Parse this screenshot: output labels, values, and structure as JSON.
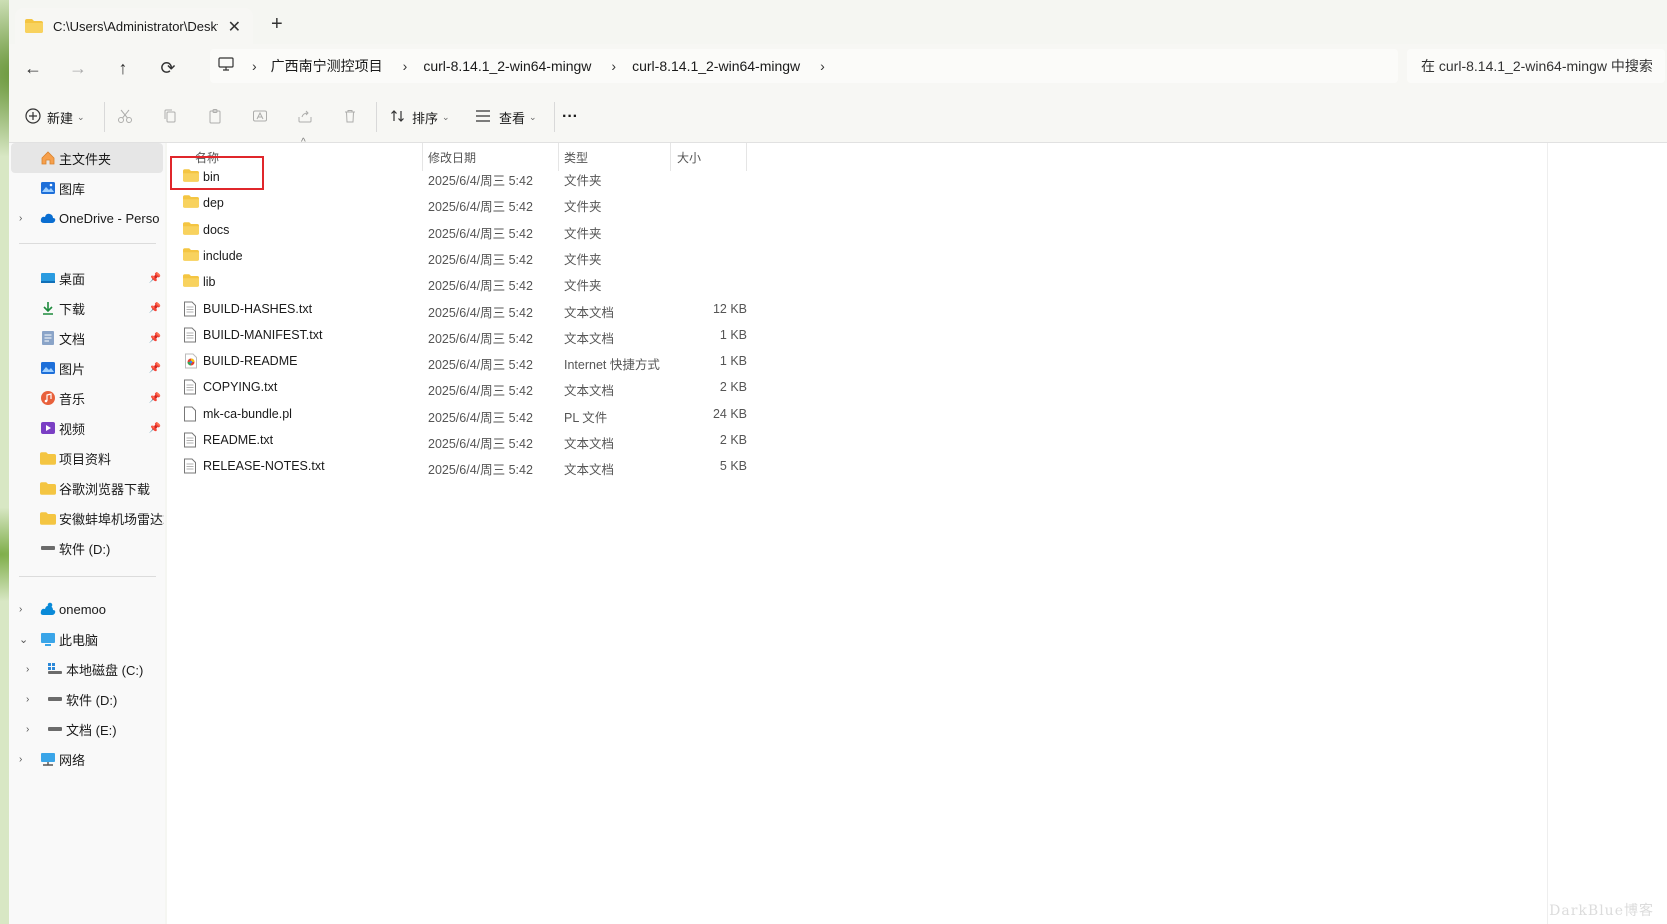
{
  "tab": {
    "title": "C:\\Users\\Administrator\\Desktop",
    "close": "✕",
    "new": "+"
  },
  "nav": {
    "back": "←",
    "forward": "→",
    "up": "↑",
    "refresh": "⟳"
  },
  "breadcrumbs": [
    "广西南宁测控项目",
    "curl-8.14.1_2-win64-mingw",
    "curl-8.14.1_2-win64-mingw"
  ],
  "search_placeholder": "在 curl-8.14.1_2-win64-mingw 中搜索",
  "commands": {
    "new": "新建",
    "sort": "排序",
    "view": "查看",
    "more": "···"
  },
  "sidebar": {
    "top": [
      {
        "label": "主文件夹",
        "icon": "home-icon"
      },
      {
        "label": "图库",
        "icon": "gallery-icon"
      },
      {
        "label": "OneDrive - Perso",
        "icon": "cloud-icon"
      }
    ],
    "quick": [
      {
        "label": "桌面",
        "icon": "desktop-icon"
      },
      {
        "label": "下载",
        "icon": "download-icon"
      },
      {
        "label": "文档",
        "icon": "document-icon"
      },
      {
        "label": "图片",
        "icon": "picture-icon"
      },
      {
        "label": "音乐",
        "icon": "music-icon"
      },
      {
        "label": "视频",
        "icon": "video-icon"
      },
      {
        "label": "项目资料",
        "icon": "folder-icon"
      },
      {
        "label": "谷歌浏览器下载",
        "icon": "folder-icon"
      },
      {
        "label": "安徽蚌埠机场雷达站",
        "icon": "folder-icon"
      },
      {
        "label": "软件 (D:)",
        "icon": "drive-icon"
      }
    ],
    "bottom": [
      {
        "label": "onemoo",
        "icon": "cloud-user-icon"
      },
      {
        "label": "此电脑",
        "icon": "pc-icon"
      },
      {
        "label": "本地磁盘 (C:)",
        "icon": "system-drive-icon"
      },
      {
        "label": "软件 (D:)",
        "icon": "drive-icon"
      },
      {
        "label": "文档 (E:)",
        "icon": "drive-icon"
      },
      {
        "label": "网络",
        "icon": "network-icon"
      }
    ]
  },
  "columns": {
    "name": "名称",
    "date": "修改日期",
    "type": "类型",
    "size": "大小"
  },
  "files": [
    {
      "name": "bin",
      "date": "2025/6/4/周三 5:42",
      "type": "文件夹",
      "size": "",
      "kind": "folder"
    },
    {
      "name": "dep",
      "date": "2025/6/4/周三 5:42",
      "type": "文件夹",
      "size": "",
      "kind": "folder"
    },
    {
      "name": "docs",
      "date": "2025/6/4/周三 5:42",
      "type": "文件夹",
      "size": "",
      "kind": "folder"
    },
    {
      "name": "include",
      "date": "2025/6/4/周三 5:42",
      "type": "文件夹",
      "size": "",
      "kind": "folder"
    },
    {
      "name": "lib",
      "date": "2025/6/4/周三 5:42",
      "type": "文件夹",
      "size": "",
      "kind": "folder"
    },
    {
      "name": "BUILD-HASHES.txt",
      "date": "2025/6/4/周三 5:42",
      "type": "文本文档",
      "size": "12 KB",
      "kind": "text"
    },
    {
      "name": "BUILD-MANIFEST.txt",
      "date": "2025/6/4/周三 5:42",
      "type": "文本文档",
      "size": "1 KB",
      "kind": "text"
    },
    {
      "name": "BUILD-README",
      "date": "2025/6/4/周三 5:42",
      "type": "Internet 快捷方式",
      "size": "1 KB",
      "kind": "link"
    },
    {
      "name": "COPYING.txt",
      "date": "2025/6/4/周三 5:42",
      "type": "文本文档",
      "size": "2 KB",
      "kind": "text"
    },
    {
      "name": "mk-ca-bundle.pl",
      "date": "2025/6/4/周三 5:42",
      "type": "PL 文件",
      "size": "24 KB",
      "kind": "blank"
    },
    {
      "name": "README.txt",
      "date": "2025/6/4/周三 5:42",
      "type": "文本文档",
      "size": "2 KB",
      "kind": "text"
    },
    {
      "name": "RELEASE-NOTES.txt",
      "date": "2025/6/4/周三 5:42",
      "type": "文本文档",
      "size": "5 KB",
      "kind": "text"
    }
  ],
  "watermark": "DarkBlue博客",
  "colors": {
    "folder": "#f4c542",
    "accent": "#0067c0",
    "highlight": "#e0262b"
  }
}
